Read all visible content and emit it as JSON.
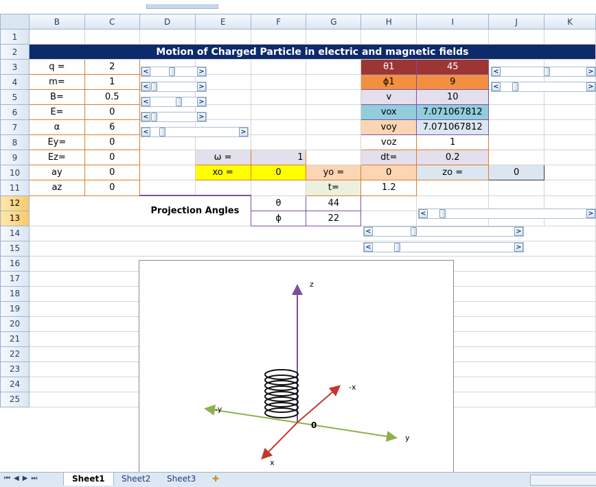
{
  "columns": [
    "B",
    "C",
    "D",
    "E",
    "F",
    "G",
    "H",
    "I",
    "J",
    "K"
  ],
  "rows": [
    "1",
    "2",
    "3",
    "4",
    "5",
    "6",
    "7",
    "8",
    "9",
    "10",
    "11",
    "12",
    "13",
    "14",
    "15",
    "16",
    "17",
    "18",
    "19",
    "20",
    "21",
    "22",
    "23",
    "24",
    "25"
  ],
  "title": "Motion of Charged Particle in electric and magnetic fields",
  "params": {
    "q_label": "q =",
    "q_value": "2",
    "m_label": "m=",
    "m_value": "1",
    "B_label": "B=",
    "B_value": "0.5",
    "E_label": "E=",
    "E_value": "0",
    "alpha_label": "α",
    "alpha_value": "6",
    "Ey_label": "Ey=",
    "Ey_value": "0",
    "Ez_label": "Ez=",
    "Ez_value": "0",
    "ay_label": "ay",
    "ay_value": "0",
    "az_label": "az",
    "az_value": "0"
  },
  "right": {
    "theta1_label": "θ1",
    "theta1_value": "45",
    "phi1_label": "ϕ1",
    "phi1_value": "9",
    "v_label": "v",
    "v_value": "10",
    "vox_label": "vox",
    "vox_value": "7.071067812",
    "voy_label": "voy",
    "voy_value": "7.071067812",
    "voz_label": "voz",
    "voz_value": "1",
    "dt_label": "dt=",
    "dt_value": "0.2",
    "omega_label": "ω =",
    "omega_value": "1",
    "xo_label": "xo  =",
    "xo_value": "0",
    "yo_label": "yo  =",
    "yo_value": "0",
    "zo_label": "zo  =",
    "zo_value": "0",
    "t_label": "t=",
    "t_value": "1.2"
  },
  "projection": {
    "label": "Projection Angles",
    "theta_label": "θ",
    "theta_value": "44",
    "phi_label": "ϕ",
    "phi_value": "22"
  },
  "plot": {
    "axis_z": "z",
    "axis_negx": "-x",
    "axis_negy": "-y",
    "axis_y": "y",
    "axis_x": "x",
    "origin": "0",
    "colors": {
      "z": "#7b4f9e",
      "x": "#c0392b",
      "y": "#8db04a",
      "helix": "#111111"
    }
  },
  "sheets": {
    "active": "Sheet1",
    "tab2": "Sheet2",
    "tab3": "Sheet3"
  },
  "scroll_arrows": {
    "left": "<",
    "right": ">"
  }
}
